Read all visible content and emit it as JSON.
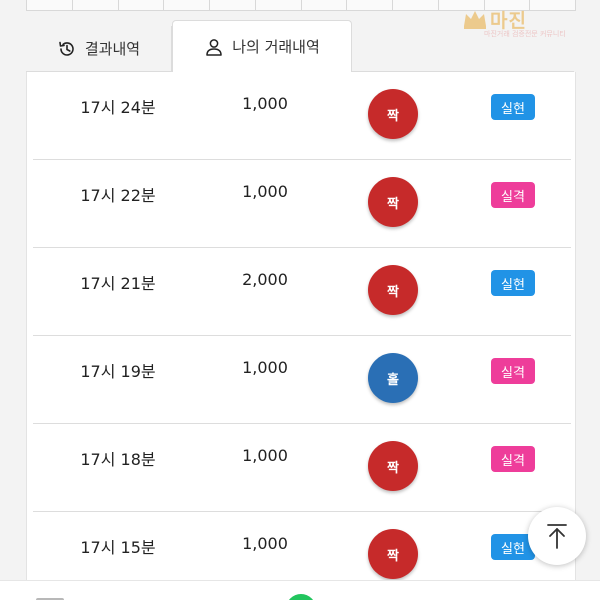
{
  "watermark": {
    "title": "마진",
    "subtitle": "마진거래 검증전문 커뮤니티"
  },
  "tabs": {
    "results_label": "결과내역",
    "mine_label": "나의 거래내역"
  },
  "rows": [
    {
      "time": "17시 24분",
      "amount": "1,000",
      "pick": "짝",
      "pick_color": "#c62a2a",
      "result": "실현",
      "result_color": "#2193e6"
    },
    {
      "time": "17시 22분",
      "amount": "1,000",
      "pick": "짝",
      "pick_color": "#c62a2a",
      "result": "실격",
      "result_color": "#ee3d9a"
    },
    {
      "time": "17시 21분",
      "amount": "2,000",
      "pick": "짝",
      "pick_color": "#c62a2a",
      "result": "실현",
      "result_color": "#2193e6"
    },
    {
      "time": "17시 19분",
      "amount": "1,000",
      "pick": "홀",
      "pick_color": "#2a6fb5",
      "result": "실격",
      "result_color": "#ee3d9a"
    },
    {
      "time": "17시 18분",
      "amount": "1,000",
      "pick": "짝",
      "pick_color": "#c62a2a",
      "result": "실격",
      "result_color": "#ee3d9a"
    },
    {
      "time": "17시 15분",
      "amount": "1,000",
      "pick": "짝",
      "pick_color": "#c62a2a",
      "result": "실현",
      "result_color": "#2193e6"
    }
  ],
  "icons": {
    "results_tab": "history-icon",
    "mine_tab": "user-icon",
    "scroll_top": "arrow-up-icon"
  }
}
